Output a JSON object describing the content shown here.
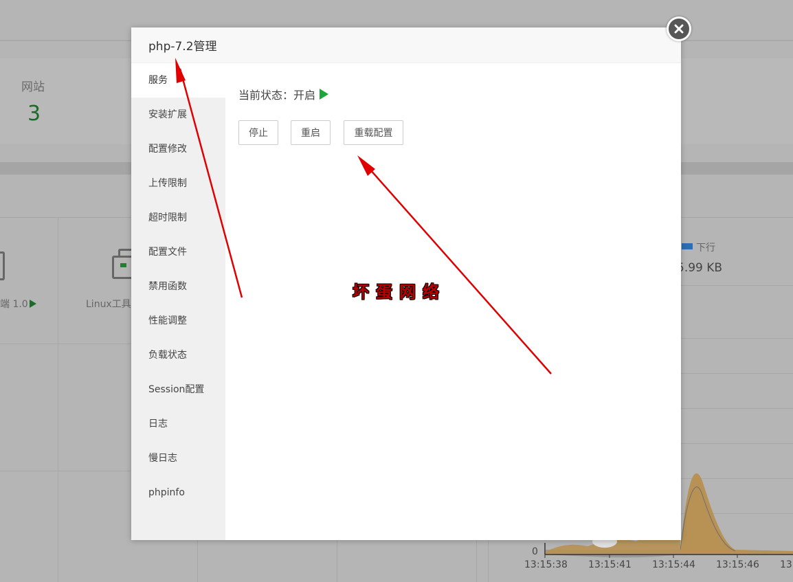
{
  "background": {
    "stat_label": "网站",
    "stat_value": "3",
    "app_left_label": "端 1.0",
    "app_tools_label": "Linux工具",
    "legend_label": "下行",
    "traffic_value": "5.99 KB",
    "y_zero": "0",
    "x_ticks": [
      "13:15:38",
      "13:15:41",
      "13:15:44",
      "13:15:46",
      "13"
    ]
  },
  "modal": {
    "title": "php-7.2管理",
    "sidebar": [
      {
        "label": "服务",
        "active": true
      },
      {
        "label": "安装扩展"
      },
      {
        "label": "配置修改"
      },
      {
        "label": "上传限制"
      },
      {
        "label": "超时限制"
      },
      {
        "label": "配置文件"
      },
      {
        "label": "禁用函数"
      },
      {
        "label": "性能调整"
      },
      {
        "label": "负载状态"
      },
      {
        "label": "Session配置"
      },
      {
        "label": "日志"
      },
      {
        "label": "慢日志"
      },
      {
        "label": "phpinfo"
      }
    ],
    "status_text": "当前状态：开启",
    "buttons": {
      "stop": "停止",
      "restart": "重启",
      "reload": "重载配置"
    }
  },
  "watermark": "坏蛋网络",
  "colors": {
    "running_green": "#20a53a",
    "annotation_red": "#e00000",
    "overlay_gray": "#b5b5b5"
  },
  "icons": [
    "close-icon",
    "play-icon",
    "toolbox-icon"
  ]
}
